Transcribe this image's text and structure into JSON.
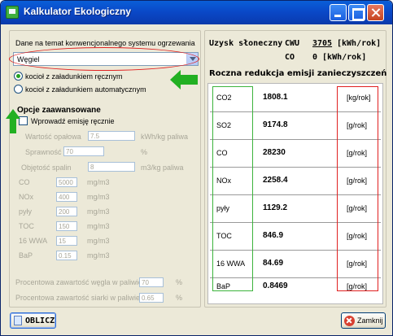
{
  "window": {
    "title": "Kalkulator Ekologiczny"
  },
  "left": {
    "system_label": "Dane na temat konwencjonalnego systemu ogrzewania",
    "fuel_select": "Węgiel",
    "radio_manual": "kocioł z załadunkiem ręcznym",
    "radio_auto": "kocioł z załadunkiem automatycznym",
    "advanced_title": "Opcje zaawansowane",
    "manual_emission": "Wprowadź emisję ręcznie",
    "fields": [
      {
        "label": "Wartość opałowa",
        "value": "7.5",
        "unit": "kWh/kg paliwa"
      },
      {
        "label": "Sprawność kotła",
        "value": "70",
        "unit": "%"
      },
      {
        "label": "Objętość spalin",
        "value": "8",
        "unit": "m3/kg paliwa"
      }
    ],
    "emissions": [
      {
        "label": "CO",
        "value": "5000",
        "unit": "mg/m3"
      },
      {
        "label": "NOx",
        "value": "400",
        "unit": "mg/m3"
      },
      {
        "label": "pyły",
        "value": "200",
        "unit": "mg/m3"
      },
      {
        "label": "TOC",
        "value": "150",
        "unit": "mg/m3"
      },
      {
        "label": "16 WWA",
        "value": "15",
        "unit": "mg/m3"
      },
      {
        "label": "BaP",
        "value": "0.15",
        "unit": "mg/m3"
      }
    ],
    "carbon_label": "Procentowa zawartość węgla w paliwie",
    "carbon_value": "70",
    "carbon_unit": "%",
    "sulfur_label": "Procentowa zawartość siarki w paliwie",
    "sulfur_value": "0.65",
    "sulfur_unit": "%"
  },
  "right": {
    "uzysk_title": "Uzysk słoneczny",
    "cwu_label": "CWU",
    "cwu_value": "3705",
    "cwu_unit": "[kWh/rok]",
    "co_label": "CO",
    "co_value": "0 [kWh/rok]",
    "reduction_title": "Roczna redukcja emisji zanieczyszczeń",
    "rows": [
      {
        "name": "CO2",
        "value": "1808.1",
        "unit": "[kg/rok]"
      },
      {
        "name": "SO2",
        "value": "9174.8",
        "unit": "[g/rok]"
      },
      {
        "name": "CO",
        "value": "28230",
        "unit": "[g/rok]"
      },
      {
        "name": "NOx",
        "value": "2258.4",
        "unit": "[g/rok]"
      },
      {
        "name": "pyły",
        "value": "1129.2",
        "unit": "[g/rok]"
      },
      {
        "name": "TOC",
        "value": "846.9",
        "unit": "[g/rok]"
      },
      {
        "name": "16 WWA",
        "value": "84.69",
        "unit": "[g/rok]"
      },
      {
        "name": "BaP",
        "value": "0.8469",
        "unit": "[g/rok]"
      }
    ]
  },
  "buttons": {
    "calculate": "OBLICZ",
    "close": "Zamknij"
  },
  "colors": {
    "title_blue": "#0a49c8",
    "highlight_red": "#e02020",
    "highlight_green": "#3cb43c",
    "arrow_green": "#22b022"
  }
}
